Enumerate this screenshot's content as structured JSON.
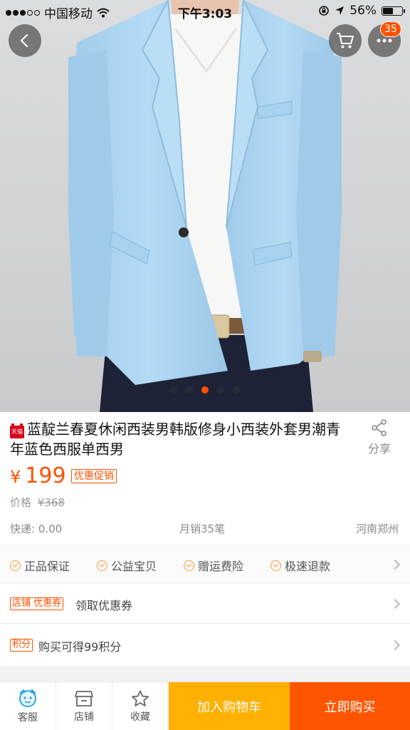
{
  "status_bar": {
    "carrier": "中国移动",
    "time": "下午3:03",
    "battery": "56%",
    "battery_level": 0.56
  },
  "hero": {
    "image_count": 5,
    "active_index": 2,
    "cart_badge": "35"
  },
  "product": {
    "title": "蓝靛兰春夏休闲西装男韩版修身小西装外套男潮青年蓝色西服单西男",
    "store_badge": "天猫",
    "share_label": "分享",
    "currency": "¥",
    "price": "199",
    "promo_tag": "优惠促销",
    "orig_label": "价格",
    "orig_price": "¥368",
    "shipping": "快递: 0.00",
    "monthly_sales": "月销35笔",
    "location": "河南郑州"
  },
  "services": {
    "guarantees": [
      "正品保证",
      "公益宝贝",
      "赠运费险",
      "极速退款"
    ],
    "coupon_tag": "店铺 优惠券",
    "coupon_label": "领取优惠券",
    "points_tag": "积分",
    "points_label": "购买可得99积分"
  },
  "bottom_bar": {
    "service_label": "客服",
    "store_label": "店铺",
    "favorite_label": "收藏",
    "add_cart_label": "加入购物车",
    "buy_now_label": "立即购买"
  },
  "colors": {
    "accent": "#ff5000",
    "cart_button": "#ffb000",
    "buy_button": "#ff5400",
    "jacket": "#a9d3f0"
  },
  "icons": [
    "back-icon",
    "cart-icon",
    "more-icon",
    "share-icon",
    "customer-service-icon",
    "store-icon",
    "star-icon",
    "check-icon",
    "chevron-right-icon"
  ]
}
